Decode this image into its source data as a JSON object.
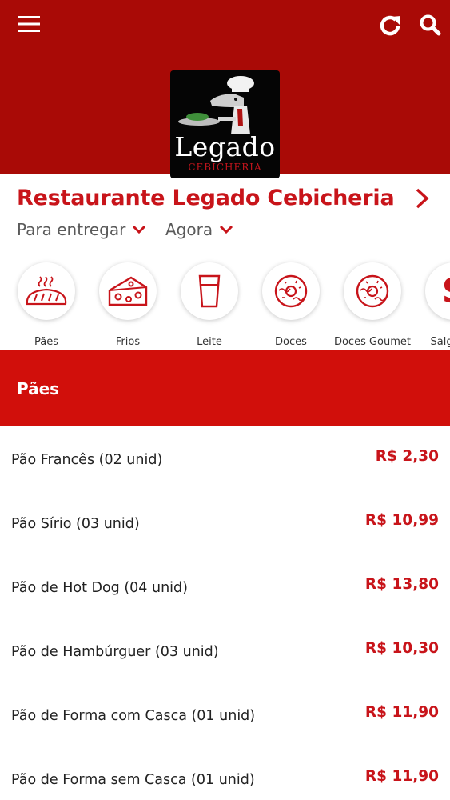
{
  "header": {
    "menu_icon": "hamburger-menu-icon",
    "refresh_icon": "refresh-icon",
    "search_icon": "search-icon",
    "background_color": "#a90a06",
    "logo": {
      "title": "Legado",
      "subtitle": "CEBICHERIA"
    }
  },
  "restaurant": {
    "name": "Restaurante Legado Cebicheria",
    "delivery_option": "Para entregar",
    "time_option": "Agora",
    "accent_color": "#c8141a"
  },
  "categories": [
    {
      "label": "Pães",
      "icon": "bread-icon"
    },
    {
      "label": "Frios",
      "icon": "cheese-icon"
    },
    {
      "label": "Leite",
      "icon": "glass-icon"
    },
    {
      "label": "Doces",
      "icon": "donut-icon"
    },
    {
      "label": "Doces Goumet",
      "icon": "donut-icon"
    },
    {
      "label": "Salgados",
      "icon": "salgados-icon"
    }
  ],
  "section": {
    "title": "Pães",
    "color": "#d10f0b"
  },
  "products": [
    {
      "name": "Pão Francês (02 unid)",
      "price": "R$ 2,30"
    },
    {
      "name": "Pão Sírio (03 unid)",
      "price": "R$ 10,99"
    },
    {
      "name": "Pão de Hot Dog (04 unid)",
      "price": "R$ 13,80"
    },
    {
      "name": "Pão de Hambúrguer (03 unid)",
      "price": "R$ 10,30"
    },
    {
      "name": "Pão de Forma com Casca (01 unid)",
      "price": "R$ 11,90"
    },
    {
      "name": "Pão de Forma sem Casca (01 unid)",
      "price": "R$ 11,90"
    }
  ]
}
